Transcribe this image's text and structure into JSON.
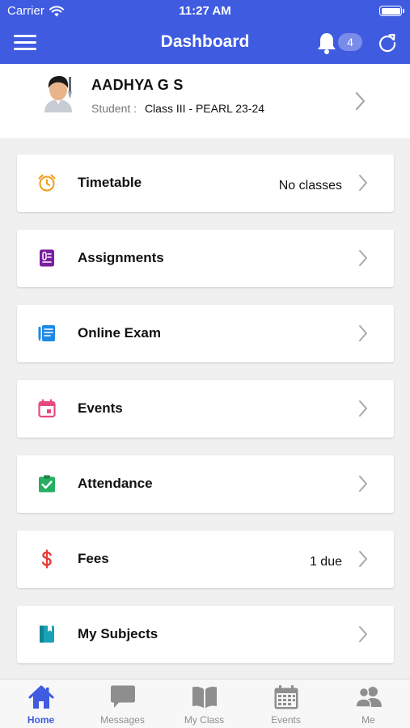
{
  "status_bar": {
    "carrier": "Carrier",
    "time": "11:27 AM"
  },
  "header": {
    "title": "Dashboard",
    "notification_count": "4"
  },
  "profile": {
    "name": "AADHYA G S",
    "role_label": "Student :",
    "class_label": "Class III - PEARL 23-24"
  },
  "menu": [
    {
      "label": "Timetable",
      "value": "No classes",
      "icon": "alarm-clock-icon",
      "color": "#f39c12"
    },
    {
      "label": "Assignments",
      "value": "",
      "icon": "assignment-icon",
      "color": "#7b1fa2"
    },
    {
      "label": "Online Exam",
      "value": "",
      "icon": "online-exam-icon",
      "color": "#1e88e5"
    },
    {
      "label": "Events",
      "value": "",
      "icon": "calendar-icon",
      "color": "#e84a7f"
    },
    {
      "label": "Attendance",
      "value": "",
      "icon": "clipboard-check-icon",
      "color": "#27ae60"
    },
    {
      "label": "Fees",
      "value": "1 due",
      "icon": "dollar-icon",
      "color": "#e53935"
    },
    {
      "label": "My Subjects",
      "value": "",
      "icon": "book-icon",
      "color": "#17a2b8"
    }
  ],
  "tabs": [
    {
      "label": "Home",
      "icon": "home-icon",
      "active": true
    },
    {
      "label": "Messages",
      "icon": "chat-icon",
      "active": false
    },
    {
      "label": "My Class",
      "icon": "open-book-icon",
      "active": false
    },
    {
      "label": "Events",
      "icon": "calendar-icon",
      "active": false
    },
    {
      "label": "Me",
      "icon": "people-icon",
      "active": false
    }
  ],
  "colors": {
    "primary": "#3f5be0",
    "inactive_tab": "#8e8e8e",
    "background": "#f0f0f0"
  }
}
